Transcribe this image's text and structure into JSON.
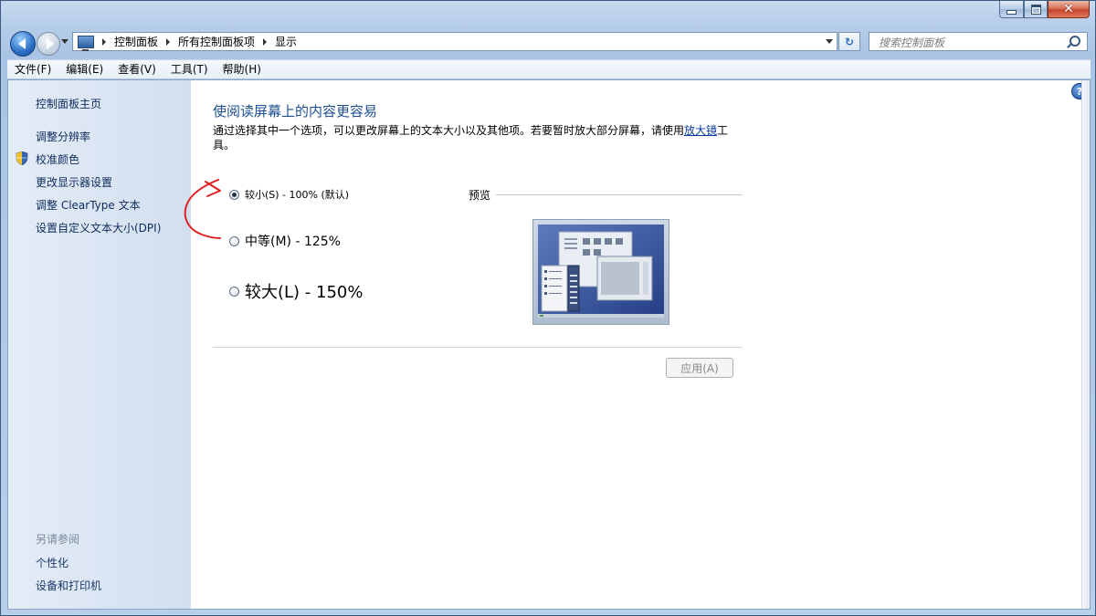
{
  "nav": {
    "breadcrumbs": [
      "控制面板",
      "所有控制面板项",
      "显示"
    ],
    "search_placeholder": "搜索控制面板"
  },
  "menu": [
    "文件(F)",
    "编辑(E)",
    "查看(V)",
    "工具(T)",
    "帮助(H)"
  ],
  "sidebar": {
    "home": "控制面板主页",
    "links": [
      "调整分辨率",
      "校准颜色",
      "更改显示器设置",
      "调整 ClearType 文本",
      "设置自定义文本大小(DPI)"
    ],
    "see_also_heading": "另请参阅",
    "see_also": [
      "个性化",
      "设备和打印机"
    ]
  },
  "main": {
    "title": "使阅读屏幕上的内容更容易",
    "description_before": "通过选择其中一个选项，可以更改屏幕上的文本大小以及其他项。若要暂时放大部分屏幕，请使用",
    "magnifier_link": "放大镜",
    "description_after": "工具。",
    "options": [
      {
        "label": "较小(S) - 100% (默认)",
        "checked": true
      },
      {
        "label": "中等(M) - 125%",
        "checked": false
      },
      {
        "label": "较大(L) - 150%",
        "checked": false
      }
    ],
    "preview_label": "预览",
    "apply_label": "应用(A)"
  },
  "colors": {
    "title": "#1d4f93",
    "annotation": "#e02020"
  }
}
